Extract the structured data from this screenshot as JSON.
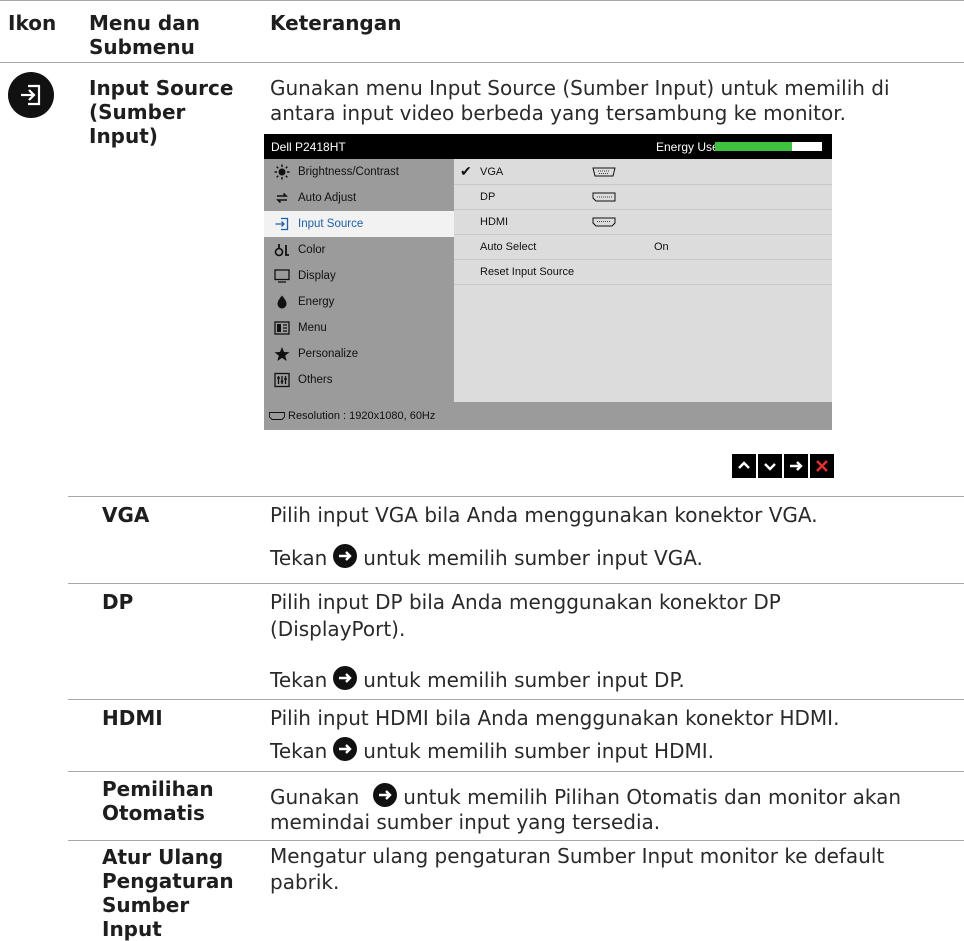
{
  "header": {
    "col_icon": "Ikon",
    "col_menu": "Menu dan Submenu",
    "col_desc": "Keterangan"
  },
  "input_source": {
    "icon": "input-source-icon",
    "title": "Input Source (Sumber Input)",
    "description": "Gunakan menu Input Source (Sumber Input) untuk memilih di antara input video berbeda yang tersambung ke monitor."
  },
  "osd": {
    "model": "Dell P2418HT",
    "energy_label": "Energy Use",
    "energy_level": 0.72,
    "menu_items": [
      {
        "label": "Brightness/Contrast",
        "icon": "brightness-icon"
      },
      {
        "label": "Auto Adjust",
        "icon": "auto-adjust-icon"
      },
      {
        "label": "Input Source",
        "icon": "input-source-icon",
        "selected": true
      },
      {
        "label": "Color",
        "icon": "color-icon"
      },
      {
        "label": "Display",
        "icon": "display-icon"
      },
      {
        "label": "Energy",
        "icon": "energy-icon"
      },
      {
        "label": "Menu",
        "icon": "menu-icon"
      },
      {
        "label": "Personalize",
        "icon": "star-icon"
      },
      {
        "label": "Others",
        "icon": "others-icon"
      }
    ],
    "submenu": [
      {
        "check": "✔",
        "name": "VGA",
        "connector": "vga-connector-icon",
        "value": ""
      },
      {
        "check": "",
        "name": "DP",
        "connector": "dp-connector-icon",
        "value": ""
      },
      {
        "check": "",
        "name": "HDMI",
        "connector": "hdmi-connector-icon",
        "value": ""
      },
      {
        "check": "",
        "name": "Auto Select",
        "connector": "",
        "value": "On"
      },
      {
        "check": "",
        "name": "Reset Input Source",
        "connector": "",
        "value": ""
      }
    ],
    "resolution": "Resolution : 1920x1080, 60Hz",
    "nav_buttons": [
      {
        "name": "up-icon",
        "glyph": "▲"
      },
      {
        "name": "down-icon",
        "glyph": "▼"
      },
      {
        "name": "right-arrow-icon",
        "glyph": "→"
      },
      {
        "name": "close-icon",
        "glyph": "✕"
      }
    ]
  },
  "rows": {
    "vga": {
      "label": "VGA",
      "line1": "Pilih input VGA bila Anda menggunakan konektor VGA.",
      "pre": "Tekan",
      "post": "untuk memilih sumber input VGA."
    },
    "dp": {
      "label": "DP",
      "line1a": "Pilih input DP bila Anda menggunakan konektor DP",
      "line1b": "(DisplayPort).",
      "pre": "Tekan",
      "post": "untuk memilih sumber input DP."
    },
    "hdmi": {
      "label": "HDMI",
      "line1": "Pilih input HDMI bila Anda menggunakan konektor HDMI.",
      "pre": "Tekan",
      "post": "untuk memilih sumber input HDMI."
    },
    "auto": {
      "label1": "Pemilihan",
      "label2": "Otomatis",
      "pre": "Gunakan",
      "post": "untuk memilih Pilihan Otomatis dan monitor akan",
      "line2": "memindai sumber input yang tersedia."
    },
    "reset": {
      "label1": "Atur Ulang",
      "label2": "Pengaturan",
      "label3": "Sumber",
      "label4": "Input",
      "line1": "Mengatur ulang pengaturan Sumber Input monitor ke default",
      "line2": "pabrik."
    }
  }
}
